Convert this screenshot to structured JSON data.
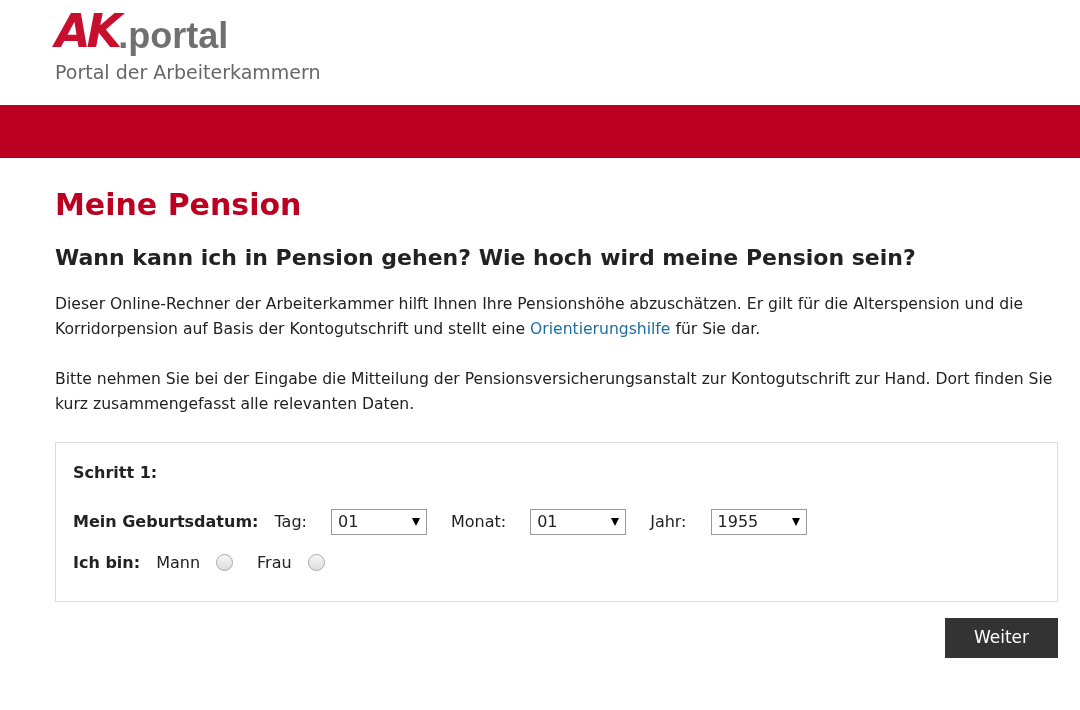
{
  "logo": {
    "mark": "AK",
    "name": ".portal",
    "tagline": "Portal der Arbeiterkammern"
  },
  "title": "Meine Pension",
  "subtitle": "Wann kann ich in Pension gehen? Wie hoch wird meine Pension sein?",
  "intro": {
    "before": "Dieser Online-Rechner der Arbeiterkammer hilft Ihnen Ihre Pensionshöhe abzuschätzen. Er gilt für die Alterspension und die Korridorpension auf Basis der Kontogutschrift und stellt eine ",
    "link": "Orientierungshilfe",
    "after": " für Sie dar."
  },
  "note": "Bitte nehmen Sie bei der Eingabe die Mitteilung der Pensionsversicherungsanstalt zur Kontogutschrift zur Hand. Dort finden Sie kurz zusammengefasst alle relevanten Daten.",
  "step": {
    "heading": "Schritt 1:",
    "birth_label": "Mein Geburtsdatum:",
    "selects": [
      {
        "label": "Tag:",
        "value": "01"
      },
      {
        "label": "Monat:",
        "value": "01"
      },
      {
        "label": "Jahr:",
        "value": "1955"
      }
    ],
    "gender_label": "Ich bin:",
    "options": [
      {
        "label": "Mann",
        "selected": false
      },
      {
        "label": "Frau",
        "selected": false
      }
    ]
  },
  "next_button": "Weiter"
}
